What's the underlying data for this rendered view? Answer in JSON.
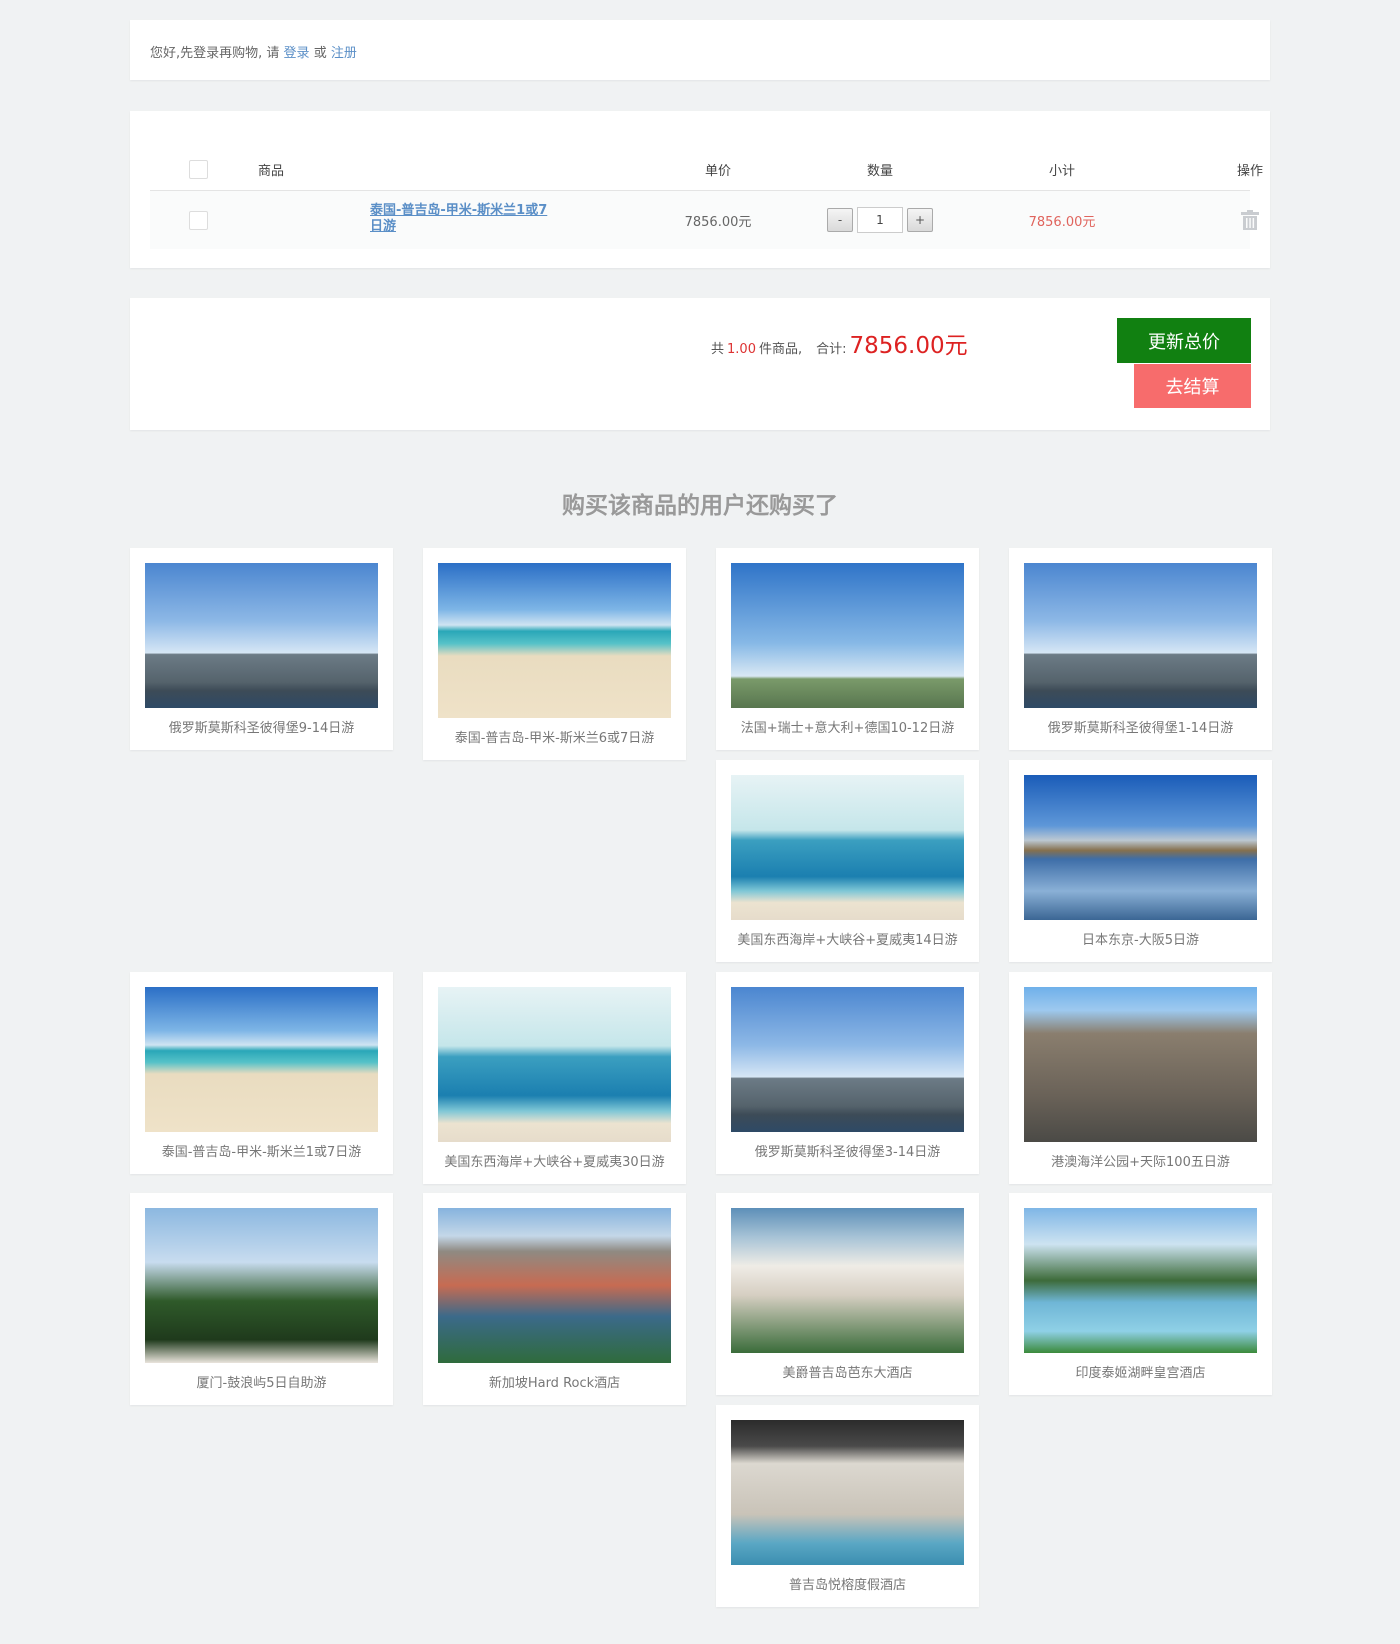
{
  "login_notice": {
    "prefix": "您好,先登录再购物, 请",
    "login_link": "登录",
    "or": "或",
    "register_link": "注册"
  },
  "cart": {
    "headers": {
      "product": "商品",
      "price": "单价",
      "quantity": "数量",
      "subtotal": "小计",
      "action": "操作"
    },
    "items": [
      {
        "name": "泰国-普吉岛-甲米-斯米兰1或7日游",
        "price": "7856.00元",
        "quantity": "1",
        "subtotal": "7856.00元",
        "minus": "-",
        "plus": "+",
        "delete_icon": "trash-icon"
      }
    ]
  },
  "summary": {
    "count_prefix": "共",
    "count": "1.00",
    "count_suffix": "件商品,",
    "total_label": "合计:",
    "total": "7856.00元",
    "update_button": "更新总价",
    "checkout_button": "去结算"
  },
  "recommendations": {
    "title": "购买该商品的用户还购买了",
    "items": [
      {
        "caption": "俄罗斯莫斯科圣彼得堡9-14日游",
        "image": "palace"
      },
      {
        "caption": "泰国-普吉岛-甲米-斯米兰6或7日游",
        "image": "beach"
      },
      {
        "caption": "法国+瑞士+意大利+德国10-12日游",
        "image": "eiffel"
      },
      {
        "caption": "俄罗斯莫斯科圣彼得堡1-14日游",
        "image": "palace"
      },
      {
        "caption": "美国东西海岸+大峡谷+夏威夷14日游",
        "image": "sea"
      },
      {
        "caption": "日本东京-大阪5日游",
        "image": "fuji"
      },
      {
        "caption": "泰国-普吉岛-甲米-斯米兰1或7日游",
        "image": "beach"
      },
      {
        "caption": "美国东西海岸+大峡谷+夏威夷30日游",
        "image": "sea"
      },
      {
        "caption": "俄罗斯莫斯科圣彼得堡3-14日游",
        "image": "palace"
      },
      {
        "caption": "港澳海洋公园+天际100五日游",
        "image": "church"
      },
      {
        "caption": "厦门-鼓浪屿5日自助游",
        "image": "signpost"
      },
      {
        "caption": "新加坡Hard Rock酒店",
        "image": "resort"
      },
      {
        "caption": "美爵普吉岛芭东大酒店",
        "image": "hotel-white"
      },
      {
        "caption": "印度泰姬湖畔皇宫酒店",
        "image": "fountain"
      },
      {
        "caption": "普吉岛悦榕度假酒店",
        "image": "pool-hotel"
      }
    ]
  }
}
